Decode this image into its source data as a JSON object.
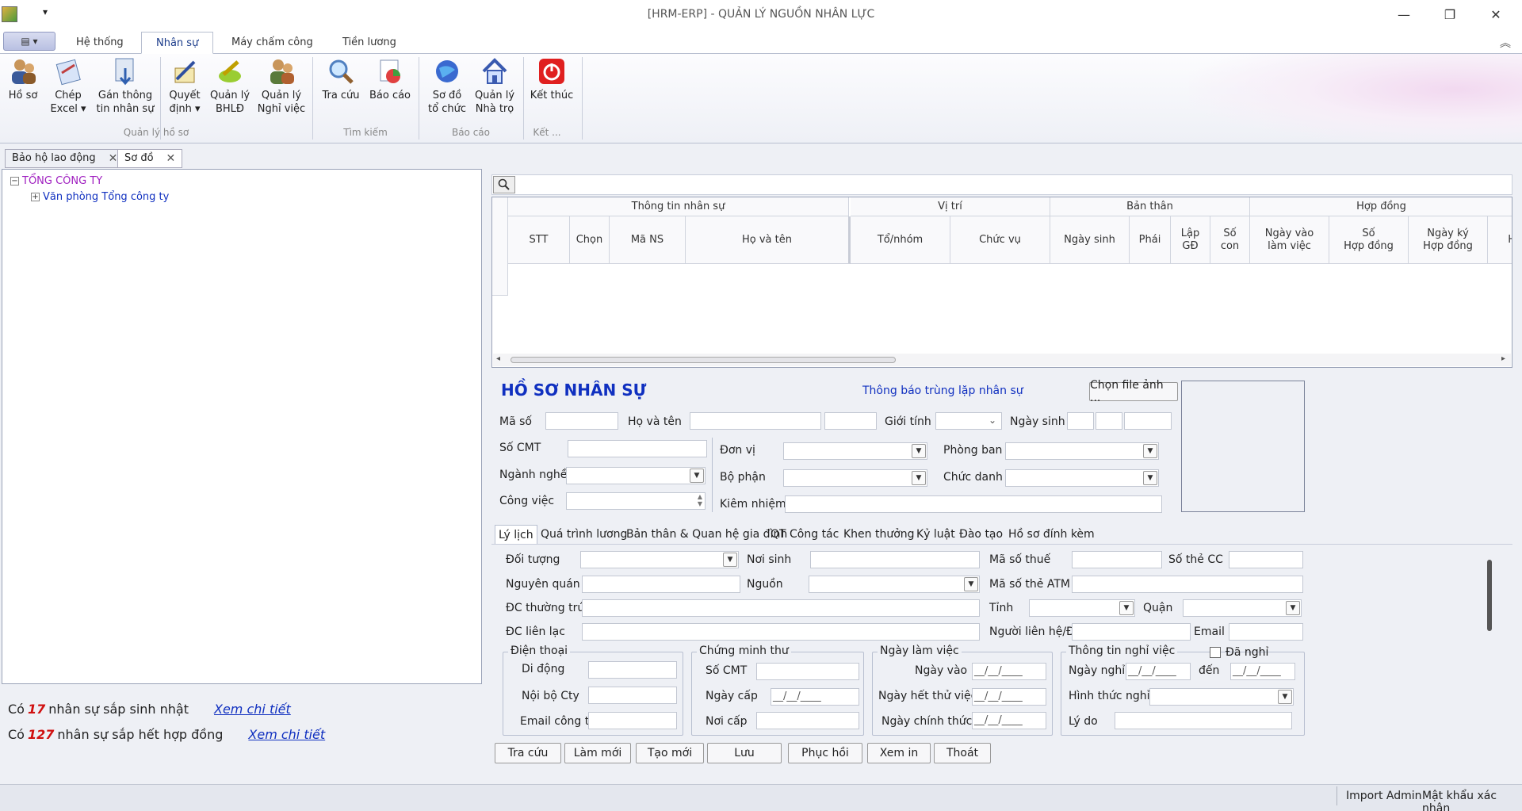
{
  "window": {
    "title": "[HRM-ERP] - QUẢN LÝ NGUỒN NHÂN LỰC"
  },
  "ribbon_tabs": [
    "Hệ thống",
    "Nhân sự",
    "Máy chấm công",
    "Tiền lương"
  ],
  "ribbon": {
    "buttons": [
      "Hồ sơ",
      "Chép\nExcel ▾",
      "Gán thông\ntin nhân sự",
      "Quyết\nđịnh ▾",
      "Quản lý\nBHLĐ",
      "Quản lý\nNghỉ việc",
      "Tra cứu",
      "Báo cáo",
      "Sơ đồ\ntổ chức",
      "Quản lý\nNhà trọ",
      "Kết thúc"
    ],
    "groups": [
      "Quản lý hồ sơ",
      "Tìm kiếm",
      "Báo cáo",
      "Kết ..."
    ]
  },
  "doc_tabs": [
    "Bảo hộ lao động",
    "Sơ đồ"
  ],
  "tree": {
    "root": "TỔNG CÔNG TY",
    "child": "Văn phòng Tổng công ty"
  },
  "notices": {
    "birthday_prefix": "Có",
    "birthday_count": "17",
    "birthday_text": "nhân sự sắp sinh nhật",
    "contract_prefix": "Có",
    "contract_count": "127",
    "contract_text": "nhân sự sắp hết hợp đồng",
    "link": "Xem chi tiết"
  },
  "grid": {
    "groups": [
      "Thông tin nhân sự",
      "Vị trí",
      "Bản thân",
      "Hợp đồng"
    ],
    "columns": [
      "STT",
      "Chọn",
      "Mã NS",
      "Họ và tên",
      "Tổ/nhóm",
      "Chức vụ",
      "Ngày sinh",
      "Phái",
      "Lập\nGĐ",
      "Số\ncon",
      "Ngày vào\nlàm việc",
      "Số\nHợp đồng",
      "Ngày ký\nHợp đồng",
      "H"
    ]
  },
  "form": {
    "title": "HỒ SƠ NHÂN SỰ",
    "dup_link": "Thông báo trùng lặp nhân sự",
    "choose_photo": "Chọn file ảnh ...",
    "labels": {
      "ma_so": "Mã số",
      "ho_ten": "Họ và tên",
      "gioi_tinh": "Giới tính",
      "ngay_sinh": "Ngày sinh",
      "so_cmt": "Số CMT",
      "don_vi": "Đơn vị",
      "phong_ban": "Phòng ban",
      "nganh_nghe": "Ngành nghề",
      "bo_phan": "Bộ phận",
      "chuc_danh": "Chức danh",
      "cong_viec": "Công việc",
      "kiem_nhiem": "Kiêm nhiệm"
    }
  },
  "inner_tabs": [
    "Lý lịch",
    "Quá trình lương",
    "Bản thân & Quan hệ gia đình",
    "QT Công tác",
    "Khen thưởng",
    "Kỷ luật",
    "Đào tạo",
    "Hồ sơ đính kèm"
  ],
  "lylich": {
    "doi_tuong": "Đối tượng",
    "noi_sinh": "Nơi sinh",
    "ma_so_thue": "Mã số thuế",
    "so_the_cc": "Số thẻ CC",
    "nguyen_quan": "Nguyên quán",
    "nguon": "Nguồn",
    "ma_so_the_atm": "Mã số thẻ ATM",
    "dc_thuong_tru": "ĐC thường trú",
    "tinh": "Tỉnh",
    "quan": "Quận",
    "dc_lien_lac": "ĐC liên lạc",
    "nguoi_lien_he": "Người liên hệ/ĐT",
    "email": "Email",
    "dien_thoai": "Điện thoại",
    "di_dong": "Di động",
    "noi_bo_cty": "Nội bộ Cty",
    "email_cong_ty": "Email công ty",
    "chung_minh_thu": "Chứng minh thư",
    "cmt_so": "Số CMT",
    "ngay_cap": "Ngày cấp",
    "noi_cap": "Nơi cấp",
    "ngay_lam_viec": "Ngày làm việc",
    "ngay_vao": "Ngày vào",
    "ngay_het_thu_viec": "Ngày hết thử việc",
    "ngay_chinh_thuc": "Ngày chính thức",
    "thong_tin_nghi_viec": "Thông tin nghỉ việc",
    "da_nghi": "Đã nghỉ",
    "ngay_nghi": "Ngày nghỉ",
    "den": "đến",
    "hinh_thuc_nghi": "Hình thức nghỉ",
    "ly_do": "Lý do",
    "date_mask": "__/__/____"
  },
  "bottom_buttons": [
    "Tra cứu",
    "Làm mới",
    "Tạo mới",
    "Lưu",
    "Phục hồi",
    "Xem in",
    "Thoát"
  ],
  "status": {
    "user": "Import Admin",
    "password": "Mật khẩu xác nhận"
  }
}
